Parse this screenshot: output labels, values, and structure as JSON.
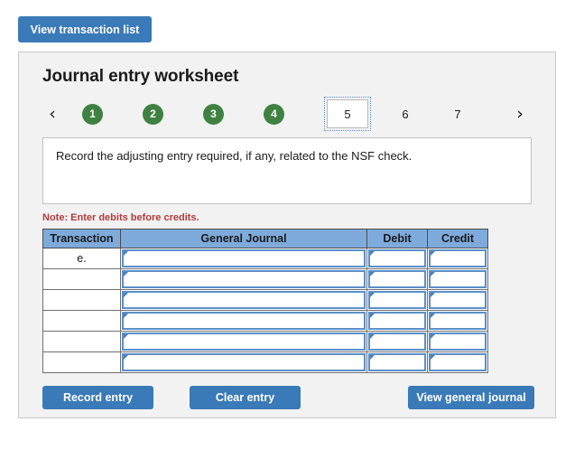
{
  "top": {
    "view_transaction_list_label": "View transaction list"
  },
  "panel": {
    "title": "Journal entry worksheet",
    "nav": {
      "prev_icon": "‹",
      "next_icon": "›"
    },
    "tabs": [
      {
        "label": "1",
        "state": "completed"
      },
      {
        "label": "2",
        "state": "completed"
      },
      {
        "label": "3",
        "state": "completed"
      },
      {
        "label": "4",
        "state": "completed"
      },
      {
        "label": "5",
        "state": "active"
      },
      {
        "label": "6",
        "state": "pending"
      },
      {
        "label": "7",
        "state": "pending"
      }
    ],
    "instruction": "Record the adjusting entry required, if any, related to the NSF check.",
    "note": "Note: Enter debits before credits.",
    "table": {
      "columns": [
        "Transaction",
        "General Journal",
        "Debit",
        "Credit"
      ],
      "rows": [
        {
          "transaction": "e.",
          "general_journal": "",
          "debit": "",
          "credit": ""
        },
        {
          "transaction": "",
          "general_journal": "",
          "debit": "",
          "credit": ""
        },
        {
          "transaction": "",
          "general_journal": "",
          "debit": "",
          "credit": ""
        },
        {
          "transaction": "",
          "general_journal": "",
          "debit": "",
          "credit": ""
        },
        {
          "transaction": "",
          "general_journal": "",
          "debit": "",
          "credit": ""
        },
        {
          "transaction": "",
          "general_journal": "",
          "debit": "",
          "credit": ""
        }
      ]
    },
    "actions": {
      "record_entry_label": "Record entry",
      "clear_entry_label": "Clear entry",
      "view_general_journal_label": "View general journal"
    }
  },
  "colors": {
    "primary_blue": "#3a7ab8",
    "tab_green": "#3f8141",
    "header_blue": "#7fabdc",
    "note_red": "#b33a3a",
    "panel_bg": "#f2f2f2"
  }
}
